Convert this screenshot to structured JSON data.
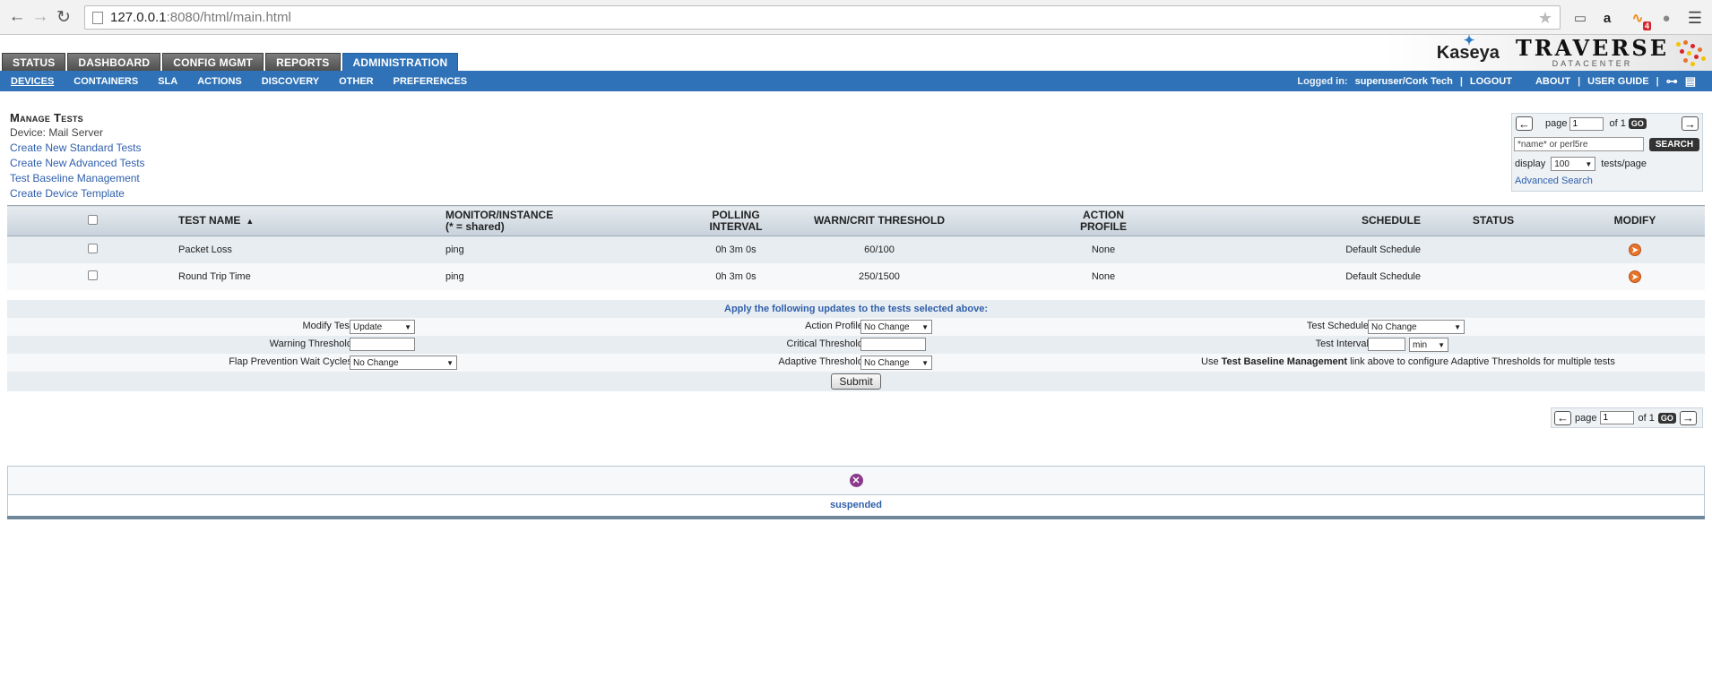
{
  "browser": {
    "url_host": "127.0.0.1",
    "url_path": ":8080/html/main.html",
    "rss_badge": "4"
  },
  "tabs": [
    "STATUS",
    "DASHBOARD",
    "CONFIG MGMT",
    "REPORTS",
    "ADMINISTRATION"
  ],
  "active_tab": "ADMINISTRATION",
  "brand": {
    "kaseya": "Kaseya",
    "traverse": "TRAVERSE",
    "datacenter": "DATACENTER"
  },
  "subnav": {
    "items": [
      "DEVICES",
      "CONTAINERS",
      "SLA",
      "ACTIONS",
      "DISCOVERY",
      "OTHER",
      "PREFERENCES"
    ],
    "active": "DEVICES",
    "logged_in_label": "Logged in:",
    "user": "superuser/Cork Tech",
    "logout": "LOGOUT",
    "about": "ABOUT",
    "user_guide": "USER GUIDE"
  },
  "manage": {
    "title": "Manage Tests",
    "device": "Device: Mail Server",
    "links": [
      "Create New Standard Tests",
      "Create New Advanced Tests",
      "Test Baseline Management",
      "Create Device Template"
    ]
  },
  "search": {
    "page_label": "page",
    "page_value": "1",
    "of_label": "of 1",
    "go": "GO",
    "placeholder": "*name* or perl5re",
    "search_btn": "SEARCH",
    "display_label": "display",
    "display_value": "100",
    "per_page_label": "tests/page",
    "advanced": "Advanced Search"
  },
  "table": {
    "headers": {
      "test_name": "TEST NAME",
      "monitor_1": "MONITOR/INSTANCE",
      "monitor_2": "(* = shared)",
      "polling_1": "POLLING",
      "polling_2": "INTERVAL",
      "threshold": "WARN/CRIT THRESHOLD",
      "action_1": "ACTION",
      "action_2": "PROFILE",
      "schedule": "SCHEDULE",
      "status": "STATUS",
      "modify": "MODIFY"
    },
    "rows": [
      {
        "name": "Packet Loss",
        "monitor": "ping",
        "interval": "0h 3m 0s",
        "threshold": "60/100",
        "action": "None",
        "schedule": "Default Schedule",
        "status": ""
      },
      {
        "name": "Round Trip Time",
        "monitor": "ping",
        "interval": "0h 3m 0s",
        "threshold": "250/1500",
        "action": "None",
        "schedule": "Default Schedule",
        "status": ""
      }
    ]
  },
  "updates": {
    "heading": "Apply the following updates to the tests selected above:",
    "modify_test_label": "Modify Test:",
    "modify_test_value": "Update",
    "action_profile_label": "Action Profile:",
    "action_profile_value": "No Change",
    "test_schedule_label": "Test Schedule:",
    "test_schedule_value": "No Change",
    "warning_label": "Warning Threshold:",
    "critical_label": "Critical Threshold:",
    "interval_label": "Test Interval:",
    "interval_unit": "min",
    "flap_label": "Flap Prevention Wait Cycles:",
    "flap_value": "No Change",
    "adaptive_label": "Adaptive Threshold:",
    "adaptive_value": "No Change",
    "note_pre": "Use",
    "note_bold": "Test Baseline Management",
    "note_post": "link above to configure Adaptive Thresholds for multiple tests",
    "submit": "Submit"
  },
  "bottom_pager": {
    "page_label": "page",
    "page_value": "1",
    "of_label": "of 1",
    "go": "GO"
  },
  "status_panel": {
    "text": "suspended"
  },
  "colors": {
    "nav_blue": "#2f72b7",
    "link_blue": "#2f5fab",
    "row_alt": "#e8edf1",
    "modify_orange": "#e8742a",
    "suspend_purple": "#8a3a8a"
  }
}
